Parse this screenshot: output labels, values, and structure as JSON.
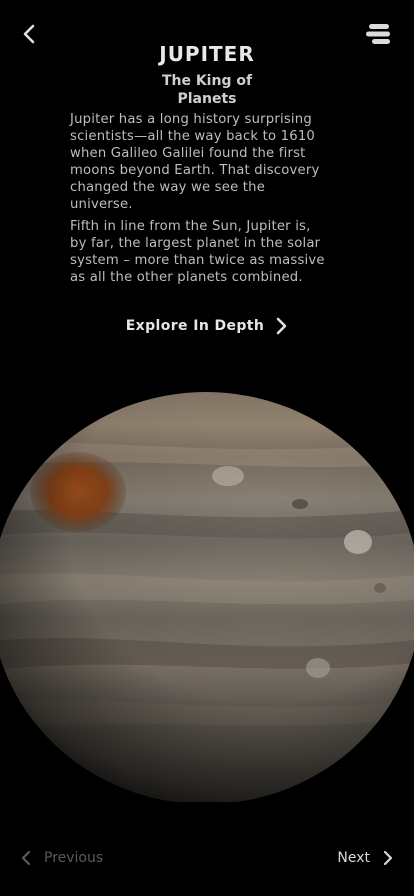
{
  "header": {
    "back_icon": "chevron-left-icon",
    "menu_icon": "menu-icon"
  },
  "planet": {
    "name": "JUPITER",
    "subtitle_line1": "The King of",
    "subtitle_line2": "Planets",
    "paragraph1_lines": [
      "Jupiter has a long history surprising",
      "scientists—all the way back to 1610",
      "when Galileo Galilei found the first",
      "moons beyond Earth. That discovery",
      "changed the way we see the",
      "universe."
    ],
    "paragraph2_lines": [
      "Fifth in line from the Sun, Jupiter is,",
      "by far, the largest planet in the solar",
      "system – more than twice as massive",
      "as all the other planets combined."
    ],
    "explore_label": "Explore In Depth"
  },
  "footer": {
    "previous_label": "Previous",
    "next_label": "Next"
  },
  "colors": {
    "background": "#000000",
    "text_primary": "#e8e8e8",
    "text_body": "#bdbdbd",
    "disabled": "#5a5a5a"
  }
}
